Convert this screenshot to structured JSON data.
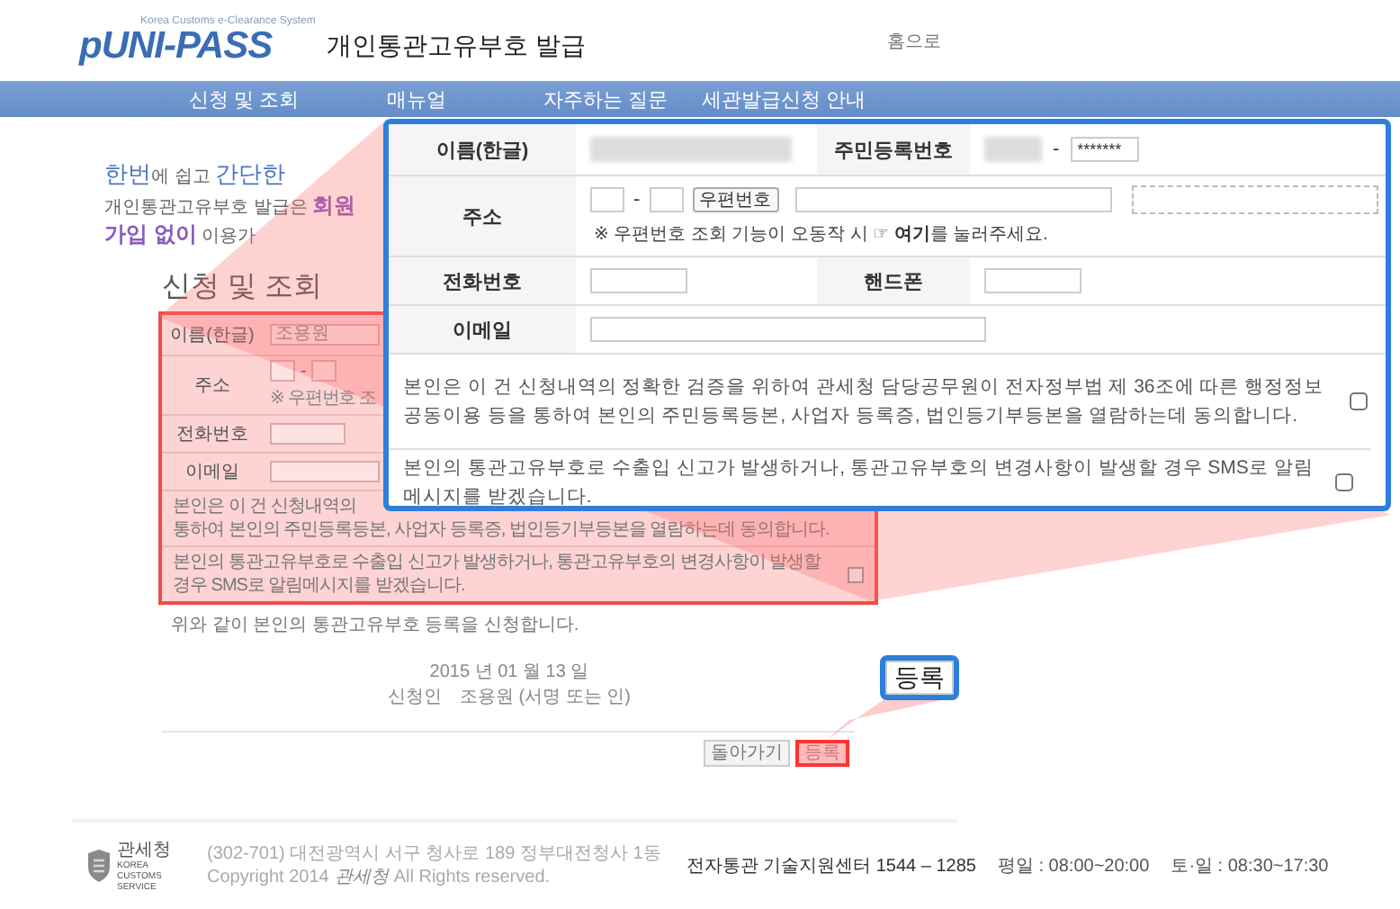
{
  "header": {
    "logo": "pUNI-PASS",
    "logo_tagline": "Korea Customs e-Clearance System",
    "title": "개인통관고유부호 발급",
    "home_link": "홈으로"
  },
  "nav": [
    "신청 및 조회",
    "매뉴얼",
    "자주하는 질문",
    "세관발급신청 안내"
  ],
  "intro": {
    "headline": "**한번**에 쉽고 **간단한**",
    "subline": "개인통관고유부호 발급은 **회원가입 없이** 이용가"
  },
  "application": {
    "title": "신청 및 조회",
    "rows": [
      {
        "kind": "name",
        "label": "이름(한글)",
        "value": "조용원"
      },
      {
        "kind": "address",
        "label": "주소",
        "separator": "-",
        "note": "※ 우편번호 조"
      },
      {
        "kind": "phone",
        "label": "전화번호"
      },
      {
        "kind": "email",
        "label": "이메일"
      }
    ],
    "consents": [
      {
        "lines": [
          "본인은 이 건 신청내역의",
          "통하여 본인의 주민등록등본, 사업자 등록증, 법인등기부등본을 열람하는데 동의합니다."
        ]
      },
      {
        "lines": [
          "본인의 통관고유부호로 수출입 신고가 발생하거나, 통관고유부호의 변경사항이 발생할 경우 SMS로 알림메시지를 받겠습니다."
        ],
        "checked": false
      }
    ],
    "statement": "위와 같이 본인의 통관고유부호 등록을 신청합니다.",
    "date": "2015 년 01 월 13 일",
    "applicant_label": "신청인",
    "applicant_value": "조용원 (서명 또는 인)",
    "buttons": [
      {
        "label": "돌아가기",
        "highlighted": false
      },
      {
        "label": "등록",
        "highlighted": true
      }
    ]
  },
  "zoomed_form": {
    "name_label": "이름(한글)",
    "id_label": "주민등록번호",
    "id_separator": "-",
    "id_back": "*******",
    "address_label": "주소",
    "zip_separator": "-",
    "zip_button": "우편번호",
    "address_note": "※ 우편번호 조회 기능이 오동작 시 ☞ **여기**를 눌러주세요.",
    "phone_label": "전화번호",
    "mobile_label": "핸드폰",
    "email_label": "이메일",
    "consents": [
      {
        "text": "본인은 이 건 신청내역의 정확한 검증을 위하여 관세청 담당공무원이 전자정부법 제 36조에 따른 행정정보 공동이용 등을 통하여 본인의 주민등록등본, 사업자 등록증, 법인등기부등본을 열람하는데 동의합니다.",
        "checked": false
      },
      {
        "text": "본인의 통관고유부호로 수출입 신고가 발생하거나, 통관고유부호의 변경사항이 발생할 경우 SMS로 알림메시지를 받겠습니다.",
        "checked": false
      }
    ]
  },
  "zoomed_button": {
    "label": "등록"
  },
  "footer": {
    "logo_name": "관세청",
    "logo_english": "KOREA CUSTOMS SERVICE",
    "address": "(302-701) 대전광역시 서구 청사로 189 정부대전청사 1동",
    "copyright_prefix": "Copyright 2014",
    "copyright_brand": "관세청",
    "copyright_suffix": "All Rights reserved.",
    "support": "전자통관 기술지원센터 1544 – 1285",
    "weekday_hours": "평일 : 08:00~20:00",
    "weekend_hours": "토·일 : 08:30~17:30"
  }
}
